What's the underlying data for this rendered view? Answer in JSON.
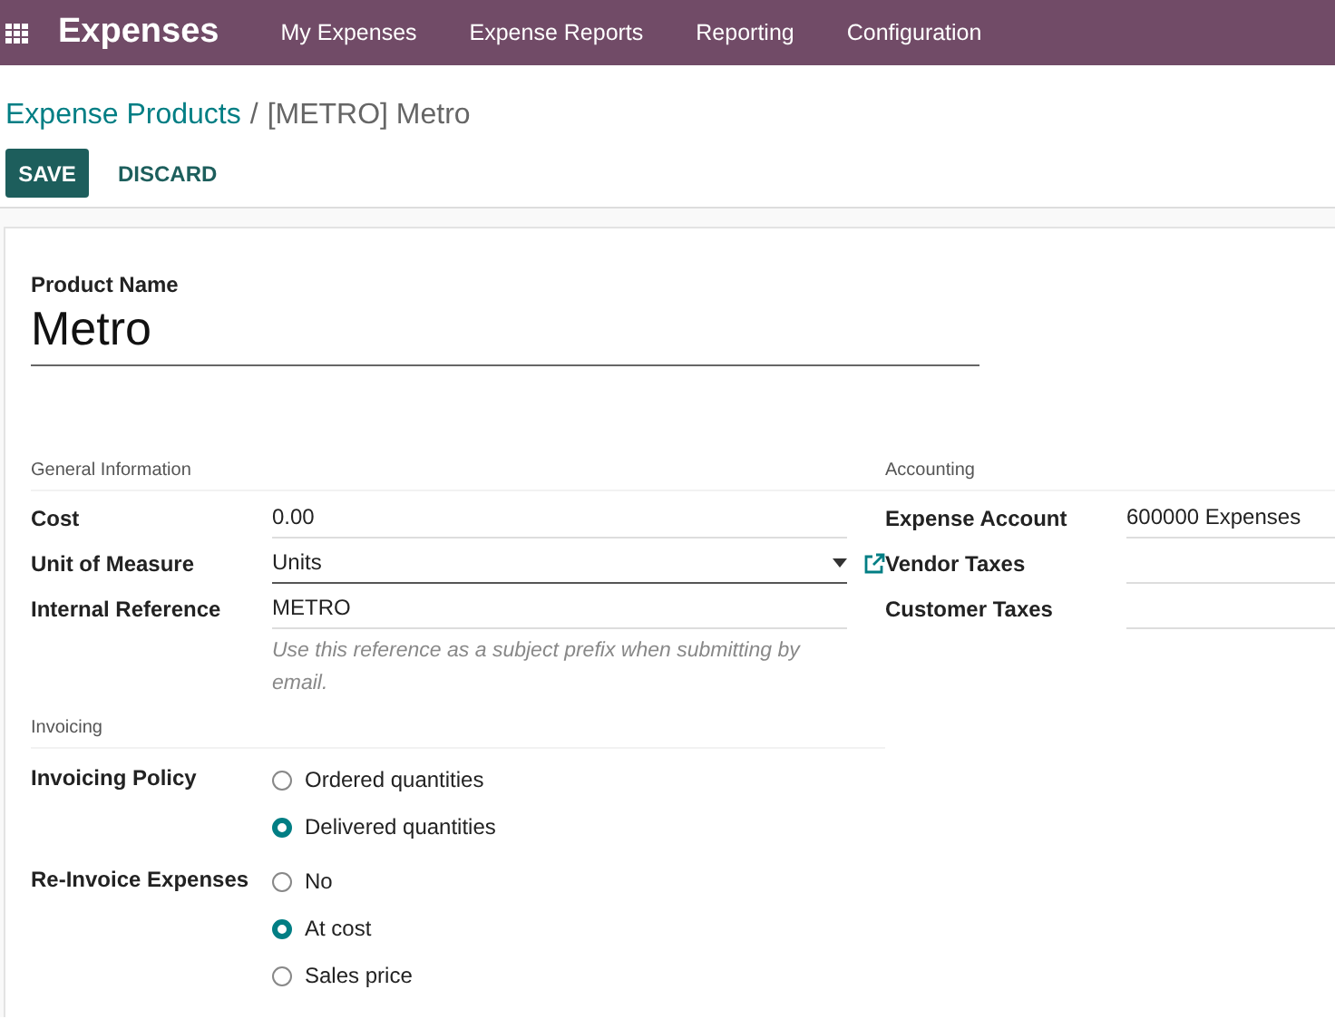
{
  "navbar": {
    "app_name": "Expenses",
    "menu": [
      "My Expenses",
      "Expense Reports",
      "Reporting",
      "Configuration"
    ]
  },
  "breadcrumb": {
    "parent": "Expense Products",
    "separator": "/",
    "current": "[METRO] Metro"
  },
  "buttons": [
    {
      "label": "SAVE",
      "kind": "primary"
    },
    {
      "label": "DISCARD",
      "kind": "link"
    }
  ],
  "product_name": {
    "label": "Product Name",
    "value": "Metro"
  },
  "general_information": {
    "title": "General Information",
    "fields": [
      {
        "label": "Cost",
        "value": "0.00",
        "kind": "text"
      },
      {
        "label": "Unit of Measure",
        "value": "Units",
        "kind": "select"
      },
      {
        "label": "Internal Reference",
        "value": "METRO",
        "kind": "text",
        "help": "Use this reference as a subject prefix when submitting by email."
      }
    ]
  },
  "accounting": {
    "title": "Accounting",
    "fields": [
      {
        "label": "Expense Account",
        "value": "600000 Expenses"
      },
      {
        "label": "Vendor Taxes"
      },
      {
        "label": "Customer Taxes"
      }
    ]
  },
  "invoicing": {
    "title": "Invoicing",
    "groups": [
      {
        "label": "Invoicing Policy",
        "options": [
          {
            "label": "Ordered quantities",
            "selected": false
          },
          {
            "label": "Delivered quantities",
            "selected": true
          }
        ]
      },
      {
        "label": "Re-Invoice Expenses",
        "options": [
          {
            "label": "No",
            "selected": false
          },
          {
            "label": "At cost",
            "selected": true
          },
          {
            "label": "Sales price",
            "selected": false
          }
        ]
      }
    ]
  }
}
